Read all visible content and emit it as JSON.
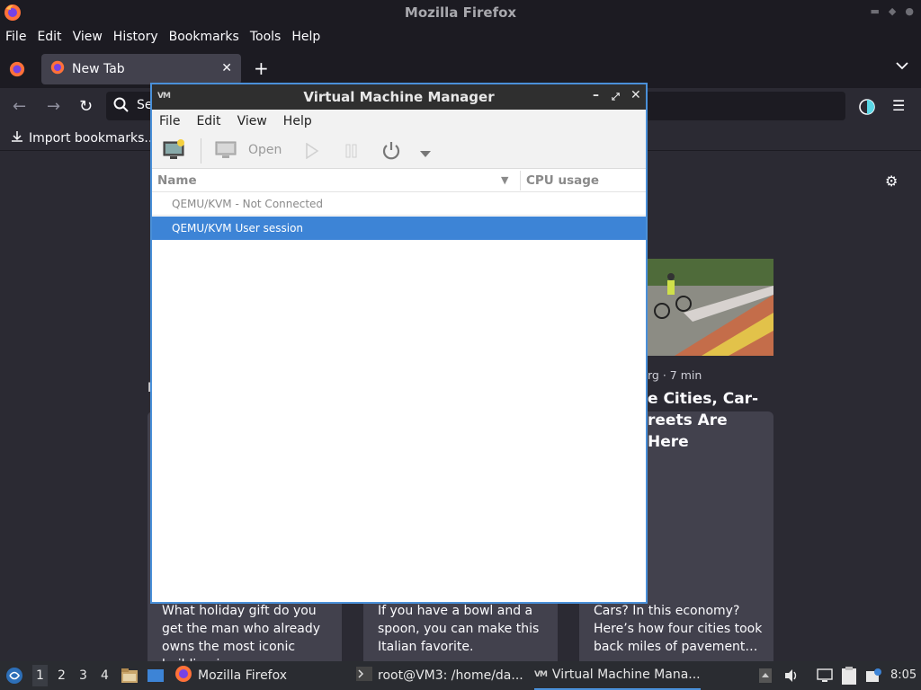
{
  "firefox": {
    "window_title": "Mozilla Firefox",
    "menu": [
      "File",
      "Edit",
      "View",
      "History",
      "Bookmarks",
      "Tools",
      "Help"
    ],
    "tab": {
      "title": "New Tab",
      "close": "✕"
    },
    "newtab_symbol": "+",
    "search_placeholder_fragment": "Se",
    "import_bookmarks": "Import bookmarks...",
    "colors": {
      "chrome": "#1c1b22",
      "content": "#2b2a33",
      "tab": "#42414d"
    }
  },
  "newtab": {
    "cards": [
      {
        "text": "What holiday gift do you get the man who already owns the most iconic building in…"
      },
      {
        "text": "If you have a bowl and a spoon, you can make this Italian favorite."
      },
      {
        "text": "Cars? In this economy? Here’s how four cities took back miles of pavement…"
      }
    ],
    "card3": {
      "meta": "rg · 7 min",
      "title": "e Cities, Car- reets Are Here"
    },
    "stray_char": "I"
  },
  "vmm": {
    "title": "Virtual Machine Manager",
    "title_icon_text": "VM",
    "menu": [
      "File",
      "Edit",
      "View",
      "Help"
    ],
    "toolbar": {
      "open_label": "Open"
    },
    "columns": {
      "name": "Name",
      "cpu": "CPU usage"
    },
    "rows": [
      {
        "label": "QEMU/KVM - Not Connected",
        "selected": false
      },
      {
        "label": "QEMU/KVM User session",
        "selected": true
      }
    ],
    "colors": {
      "selection": "#3d84d6",
      "border": "#4a90d9"
    }
  },
  "taskbar": {
    "workspaces": [
      "1",
      "2",
      "3",
      "4"
    ],
    "tasks": [
      {
        "label": "Mozilla Firefox",
        "icon": "firefox-icon"
      },
      {
        "label": "root@VM3: /home/da...",
        "icon": "terminal-icon"
      },
      {
        "label": "Virtual Machine Mana...",
        "icon": "vmm-icon"
      }
    ],
    "clock": "8:05"
  }
}
